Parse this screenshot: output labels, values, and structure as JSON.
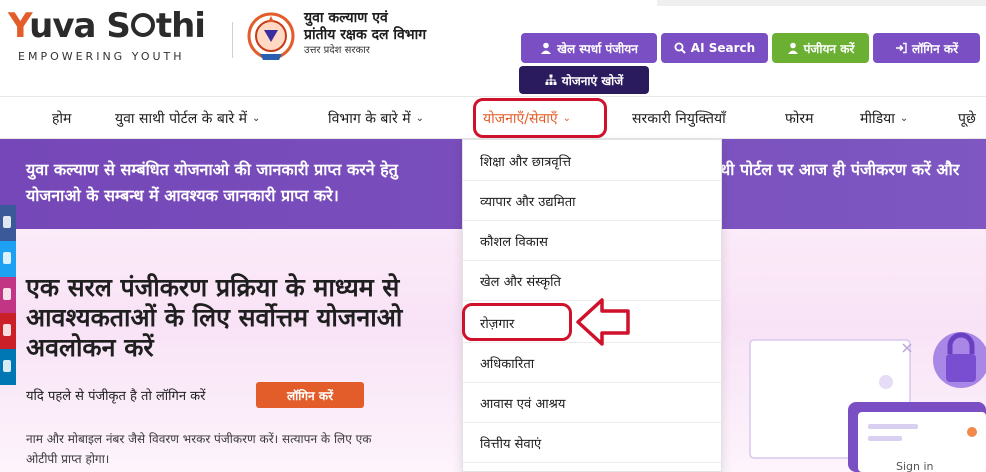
{
  "brand": {
    "name_y": "Y",
    "name_uva": "uva",
    "name_s": "S",
    "name_thi": "thi",
    "tagline": "EMPOWERING YOUTH"
  },
  "department": {
    "line1": "युवा कल्याण एवं",
    "line2": "प्रांतीय रक्षक दल विभाग",
    "line3": "उत्तर प्रदेश सरकार"
  },
  "top_buttons": {
    "sports": "खेल स्पर्धा पंजीयन",
    "ai_search": "AI Search",
    "register": "पंजीयन करें",
    "login": "लॉगिन करें",
    "find_schemes": "योजनाएं खोजें"
  },
  "nav": {
    "home": "होम",
    "about_portal": "युवा साथी पोर्टल के बारे में",
    "about_dept": "विभाग के बारे में",
    "schemes": "योजनाएँ/सेवाएँ",
    "govt_jobs": "सरकारी नियुक्तियाँ",
    "forum": "फोरम",
    "media": "मीडिया",
    "faq": "पूछे"
  },
  "banner": {
    "left_line1": "युवा कल्याण से सम्बंधित योजनाओ की जानकारी प्राप्त करने हेतु",
    "right_line1": "थी पोर्टल पर आज ही पंजीकरण करें और",
    "line2": "योजनाओ के सम्बन्ध में आवश्यक जानकारी प्राप्त करे।"
  },
  "hero": {
    "title_line1": "एक सरल पंजीकरण प्रक्रिया के माध्यम से",
    "title_line2": "आवश्यकताओं के लिए सर्वोत्तम योजनाओ",
    "title_line3": "अवलोकन करें",
    "already_registered": "यदि पहले से पंजीकृत है तो लॉगिन करें",
    "login_button": "लॉगिन करें",
    "note_line1": "नाम और मोबाइल नंबर जैसे विवरण भरकर पंजीकरण करें। सत्यापन के लिए एक",
    "note_line2": "ओटीपी प्राप्त होगा।"
  },
  "dropdown": {
    "items": [
      "शिक्षा और छात्रवृत्ति",
      "व्यापार और उद्यमिता",
      "कौशल विकास",
      "खेल और संस्कृति",
      "रोज़गार",
      "अधिकारिता",
      "आवास एवं आश्रय",
      "वित्तीय सेवाएं"
    ]
  },
  "illustration": {
    "signin_text": "Sign in"
  },
  "colors": {
    "accent_orange": "#e35d2a",
    "purple": "#7b4fc4",
    "green": "#6bb033",
    "dark_navy": "#2a1a5e",
    "highlight_red": "#d0112b"
  }
}
